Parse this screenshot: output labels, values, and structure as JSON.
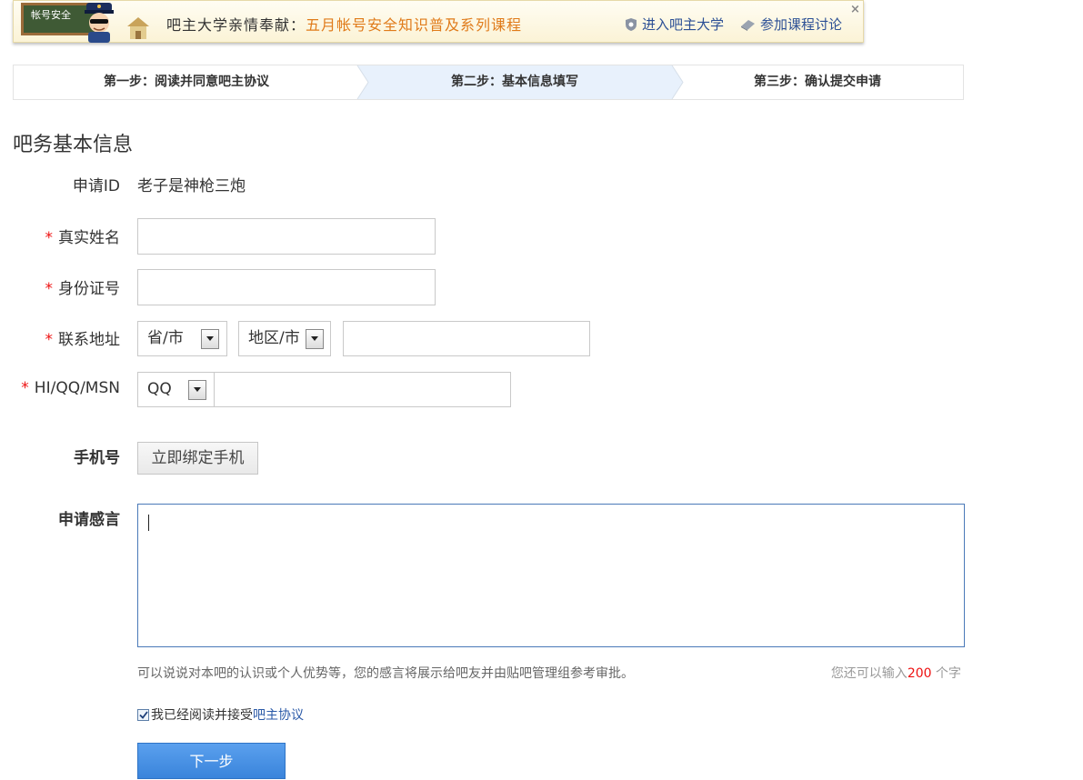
{
  "banner": {
    "badge_text": "帐号安全",
    "title_prefix": "吧主大学亲情奉献：",
    "title_highlight": "五月帐号安全知识普及系列课程",
    "link_university": "进入吧主大学",
    "link_discuss": "参加课程讨论",
    "close_glyph": "×",
    "accent_color": "#e07b1a"
  },
  "steps": [
    {
      "label": "第一步：阅读并同意吧主协议",
      "active": false
    },
    {
      "label": "第二步：基本信息填写",
      "active": true
    },
    {
      "label": "第三步：确认提交申请",
      "active": false
    }
  ],
  "section_title": "吧务基本信息",
  "form": {
    "apply_id_label": "申请ID",
    "apply_id_value": "老子是神枪三炮",
    "required_mark": "*",
    "real_name_label": "真实姓名",
    "real_name_value": "",
    "id_card_label": "身份证号",
    "id_card_value": "",
    "address_label": "联系地址",
    "province_select": "省/市",
    "city_select": "地区/市",
    "address_detail_value": "",
    "im_label": "HI/QQ/MSN",
    "im_type_select": "QQ",
    "im_value": "",
    "phone_label": "手机号",
    "bind_phone_button": "立即绑定手机",
    "remark_label": "申请感言",
    "remark_value": "",
    "remark_hint": "可以说说对本吧的认识或个人优势等，您的感言将展示给吧友并由贴吧管理组参考审批。",
    "counter_prefix": "您还可以输入",
    "counter_value": "200",
    "counter_suffix": " 个字",
    "agree_checked": true,
    "agree_text": "我已经阅读并接受",
    "agree_link": "吧主协议",
    "next_button": "下一步"
  },
  "colors": {
    "active_step_bg": "#e8f1fc",
    "link": "#2b5aa8",
    "required": "#e11111",
    "primary_button": "#3a84db"
  }
}
